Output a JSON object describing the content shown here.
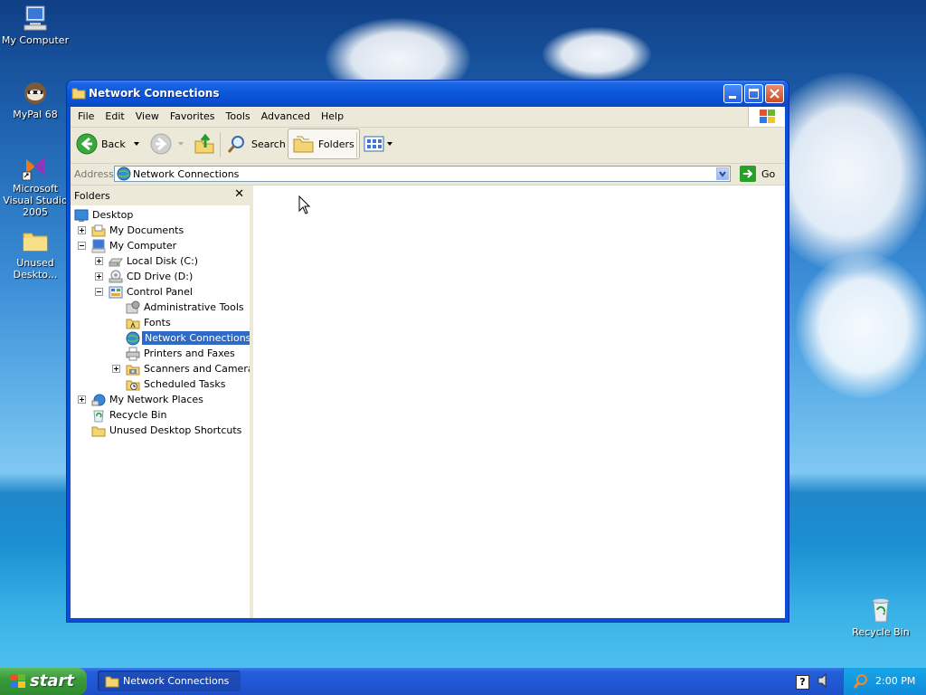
{
  "desktop": {
    "icons": [
      {
        "label": "My Computer"
      },
      {
        "label": "MyPal 68"
      },
      {
        "label": "Microsoft Visual Studio 2005"
      },
      {
        "label": "Unused Deskto..."
      },
      {
        "label": "Recycle Bin"
      }
    ]
  },
  "window": {
    "title": "Network Connections",
    "menu": [
      "File",
      "Edit",
      "View",
      "Favorites",
      "Tools",
      "Advanced",
      "Help"
    ],
    "toolbar": {
      "back_label": "Back",
      "search_label": "Search",
      "folders_label": "Folders"
    },
    "address": {
      "label": "Address",
      "value": "Network Connections",
      "go_label": "Go"
    },
    "folders_pane": {
      "title": "Folders",
      "close_glyph": "✕",
      "tree": [
        {
          "label": "Desktop"
        },
        {
          "label": "My Documents"
        },
        {
          "label": "My Computer"
        },
        {
          "label": "Local Disk (C:)"
        },
        {
          "label": "CD Drive (D:)"
        },
        {
          "label": "Control Panel"
        },
        {
          "label": "Administrative Tools"
        },
        {
          "label": "Fonts"
        },
        {
          "label": "Network Connections",
          "selected": true
        },
        {
          "label": "Printers and Faxes"
        },
        {
          "label": "Scanners and Cameras"
        },
        {
          "label": "Scheduled Tasks"
        },
        {
          "label": "My Network Places"
        },
        {
          "label": "Recycle Bin"
        },
        {
          "label": "Unused Desktop Shortcuts"
        }
      ]
    }
  },
  "taskbar": {
    "start_label": "start",
    "task_label": "Network Connections",
    "clock": "2:00 PM"
  },
  "colors": {
    "titlebar": "#0a58dc",
    "selection": "#316ac5",
    "taskbar": "#245edb",
    "start": "#3a9a3a"
  }
}
